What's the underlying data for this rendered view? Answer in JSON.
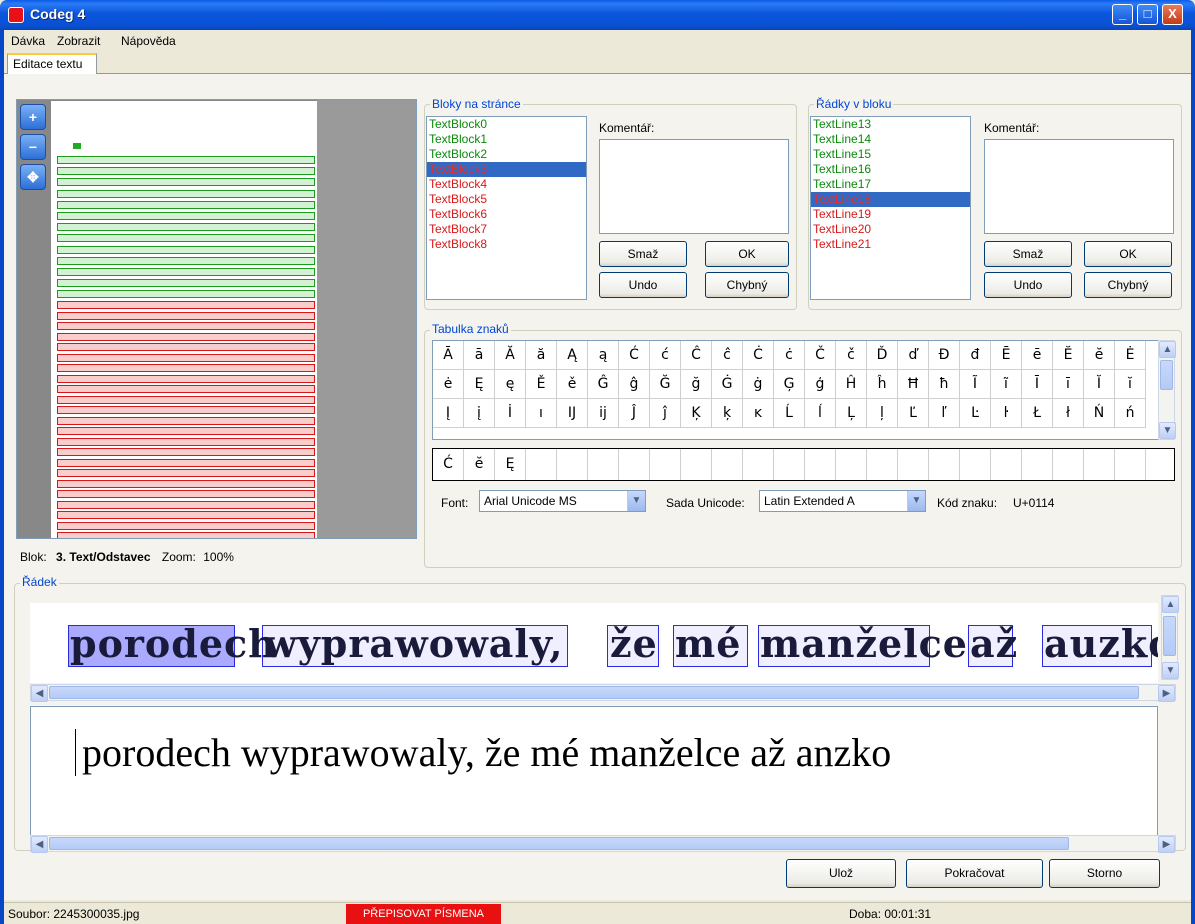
{
  "window": {
    "title": "Codeg 4",
    "controls": {
      "minimize": "_",
      "maximize": "□",
      "close": "X"
    }
  },
  "menu": [
    "Dávka",
    "Zobrazit",
    "Nápověda"
  ],
  "tab": {
    "label": "Editace textu"
  },
  "page_view": {
    "tools": [
      "zoom-in-icon",
      "zoom-out-icon",
      "move-icon"
    ],
    "status": {
      "blok_label": "Blok:",
      "blok_value": "3. Text/Odstavec",
      "zoom_label": "Zoom:",
      "zoom_value": "100%"
    }
  },
  "blocks": {
    "title": "Bloky na stránce",
    "items": [
      {
        "label": "TextBlock0",
        "state": "ok"
      },
      {
        "label": "TextBlock1",
        "state": "ok"
      },
      {
        "label": "TextBlock2",
        "state": "ok"
      },
      {
        "label": "TextBlock3",
        "state": "selected"
      },
      {
        "label": "TextBlock4",
        "state": "error"
      },
      {
        "label": "TextBlock5",
        "state": "error"
      },
      {
        "label": "TextBlock6",
        "state": "error"
      },
      {
        "label": "TextBlock7",
        "state": "error"
      },
      {
        "label": "TextBlock8",
        "state": "error"
      }
    ],
    "comment_label": "Komentář:",
    "buttons": {
      "delete": "Smaž",
      "ok": "OK",
      "undo": "Undo",
      "faulty": "Chybný"
    }
  },
  "lines": {
    "title": "Řádky v bloku",
    "items": [
      {
        "label": "TextLine13",
        "state": "ok"
      },
      {
        "label": "TextLine14",
        "state": "ok"
      },
      {
        "label": "TextLine15",
        "state": "ok"
      },
      {
        "label": "TextLine16",
        "state": "ok"
      },
      {
        "label": "TextLine17",
        "state": "ok"
      },
      {
        "label": "TextLine18",
        "state": "selected"
      },
      {
        "label": "TextLine19",
        "state": "error"
      },
      {
        "label": "TextLine20",
        "state": "error"
      },
      {
        "label": "TextLine21",
        "state": "error"
      }
    ],
    "comment_label": "Komentář:",
    "buttons": {
      "delete": "Smaž",
      "ok": "OK",
      "undo": "Undo",
      "faulty": "Chybný"
    }
  },
  "char_table": {
    "title": "Tabulka znaků",
    "rows": [
      [
        "Ā",
        "ā",
        "Ă",
        "ă",
        "Ą",
        "ą",
        "Ć",
        "ć",
        "Ĉ",
        "ĉ",
        "Ċ",
        "ċ",
        "Č",
        "č",
        "Ď",
        "ď",
        "Đ",
        "đ",
        "Ē",
        "ē",
        "Ĕ",
        "ĕ",
        "Ė"
      ],
      [
        "ė",
        "Ę",
        "ę",
        "Ě",
        "ě",
        "Ĝ",
        "ĝ",
        "Ğ",
        "ğ",
        "Ġ",
        "ġ",
        "Ģ",
        "ģ",
        "Ĥ",
        "ĥ",
        "Ħ",
        "ħ",
        "Ĩ",
        "ĩ",
        "Ī",
        "ī",
        "Ĭ",
        "ĭ"
      ],
      [
        "Į",
        "į",
        "İ",
        "ı",
        "Ĳ",
        "ĳ",
        "Ĵ",
        "ĵ",
        "Ķ",
        "ķ",
        "ĸ",
        "Ĺ",
        "ĺ",
        "Ļ",
        "ļ",
        "Ľ",
        "ľ",
        "Ŀ",
        "ŀ",
        "Ł",
        "ł",
        "Ń",
        "ń"
      ]
    ],
    "selected_chars": [
      "Ć",
      "ĕ",
      "Ę"
    ],
    "font_label": "Font:",
    "font_value": "Arial Unicode MS",
    "unicode_set_label": "Sada Unicode:",
    "unicode_set_value": "Latin Extended A",
    "char_code_label": "Kód znaku:",
    "char_code_value": "U+0114"
  },
  "line_panel": {
    "title": "Řádek",
    "image_words": [
      "porodech",
      "wyprawowaly,",
      "že",
      "mé",
      "manželce",
      "až",
      "auzko"
    ],
    "transcription": "porodech wyprawowaly, že mé manželce až anzko"
  },
  "actions": {
    "save": "Ulož",
    "continue": "Pokračovat",
    "cancel": "Storno"
  },
  "statusbar": {
    "file": "Soubor: 2245300035.jpg",
    "mode": "PŘEPISOVAT PÍSMENA",
    "time": "Doba: 00:01:31"
  },
  "colors": {
    "ok_text": "#0a8a0a",
    "error_text": "#d81818",
    "selection": "#316AC5",
    "accent": "#0046D5",
    "mode_bg": "#E81010"
  }
}
